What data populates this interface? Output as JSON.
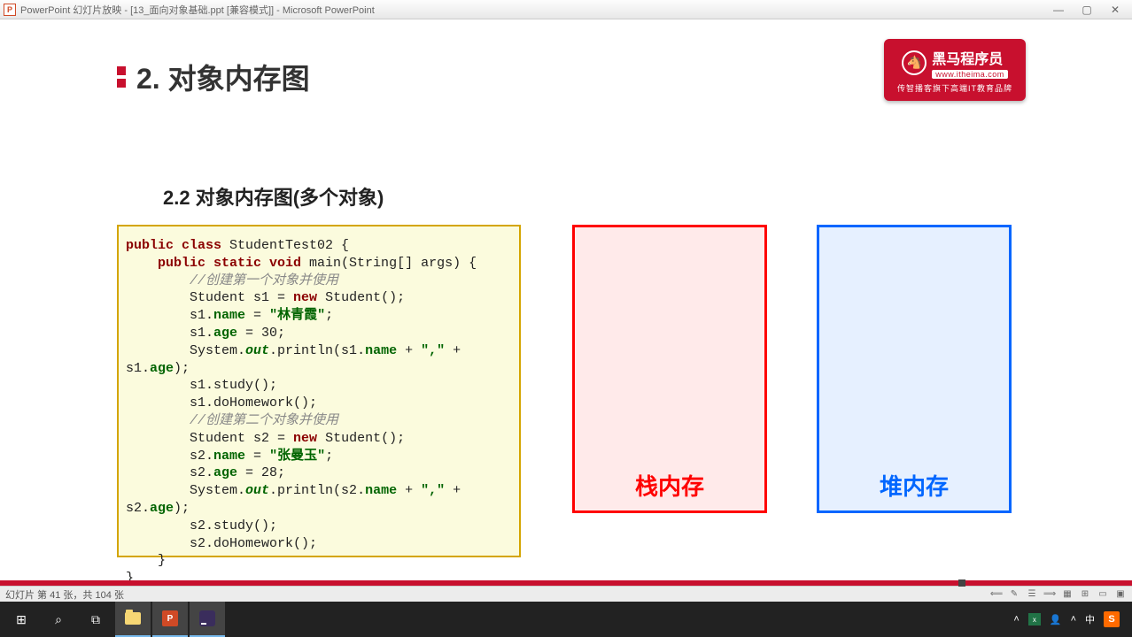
{
  "window": {
    "app_icon_letter": "P",
    "title": "PowerPoint 幻灯片放映 - [13_面向对象基础.ppt [兼容模式]] - Microsoft PowerPoint"
  },
  "logo": {
    "name": "黑马程序员",
    "url": "www.itheima.com",
    "tagline": "传智播客旗下高端IT教育品牌"
  },
  "slide": {
    "section_number": "2.",
    "section_title": "对象内存图",
    "sub_heading": "2.2 对象内存图(多个对象)",
    "code": {
      "l1_kw1": "public class",
      "l1_rest": " StudentTest02 {",
      "l2_kw1": "public static void",
      "l2_rest": " main(String[] args) {",
      "l3_cm": "//创建第一个对象并使用",
      "l4a": "Student s1 = ",
      "l4_kw": "new",
      "l4b": " Student();",
      "l5a": "s1.",
      "l5f": "name",
      "l5b": " = ",
      "l5s": "\"林青霞\"",
      "l5c": ";",
      "l6a": "s1.",
      "l6f": "age",
      "l6b": " = 30;",
      "l7a": "System.",
      "l7i": "out",
      "l7b": ".println(s1.",
      "l7f1": "name",
      "l7c": " + ",
      "l7s": "\",\"",
      "l7d": " + s1.",
      "l7f2": "age",
      "l7e": ");",
      "l8": "s1.study();",
      "l9": "s1.doHomework();",
      "l10_cm": "//创建第二个对象并使用",
      "l11a": "Student s2 = ",
      "l11_kw": "new",
      "l11b": " Student();",
      "l12a": "s2.",
      "l12f": "name",
      "l12b": " = ",
      "l12s": "\"张曼玉\"",
      "l12c": ";",
      "l13a": "s2.",
      "l13f": "age",
      "l13b": " = 28;",
      "l14a": "System.",
      "l14i": "out",
      "l14b": ".println(s2.",
      "l14f1": "name",
      "l14c": " + ",
      "l14s": "\",\"",
      "l14d": " + s2.",
      "l14f2": "age",
      "l14e": ");",
      "l15": "s2.study();",
      "l16": "s2.doHomework();",
      "l17": "}",
      "l18": "}"
    },
    "stack_label": "栈内存",
    "heap_label": "堆内存"
  },
  "status": {
    "slide_counter": "幻灯片 第 41 张，共 104 张"
  },
  "taskbar": {
    "ime": "中",
    "people": "👤"
  }
}
